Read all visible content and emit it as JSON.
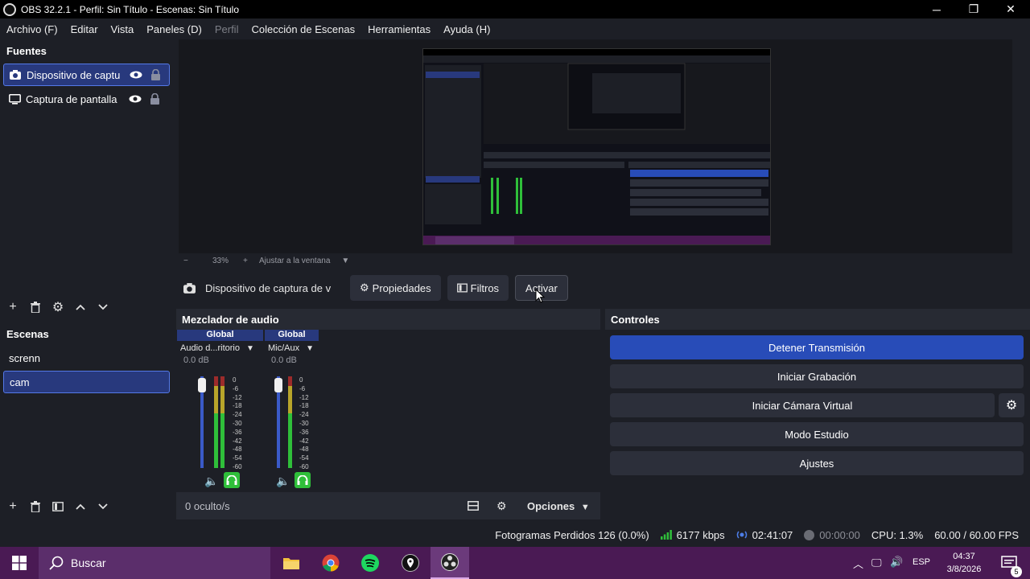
{
  "window": {
    "title": "OBS 32.2.1 - Perfil: Sin Título - Escenas: Sin Título",
    "min": "─",
    "max": "❐",
    "close": "✕"
  },
  "menu": [
    {
      "label": "Archivo (F)",
      "disabled": false
    },
    {
      "label": "Editar",
      "disabled": false
    },
    {
      "label": "Vista",
      "disabled": false
    },
    {
      "label": "Paneles (D)",
      "disabled": false
    },
    {
      "label": "Perfil",
      "disabled": true
    },
    {
      "label": "Colección de Escenas",
      "disabled": false
    },
    {
      "label": "Herramientas",
      "disabled": false
    },
    {
      "label": "Ayuda (H)",
      "disabled": false
    }
  ],
  "sources": {
    "title": "Fuentes",
    "items": [
      {
        "label": "Dispositivo de captu",
        "selected": true,
        "icon": "camera-icon"
      },
      {
        "label": "Captura de pantalla",
        "selected": false,
        "icon": "monitor-icon"
      }
    ]
  },
  "scenes": {
    "title": "Escenas",
    "items": [
      {
        "label": "screnn",
        "selected": false
      },
      {
        "label": "cam",
        "selected": true
      }
    ]
  },
  "zoom": {
    "minus": "−",
    "value": "33%",
    "plus": "+",
    "fit": "Ajustar a la ventana"
  },
  "context": {
    "source_name": "Dispositivo de captura de v",
    "properties": "Propiedades",
    "filters": "Filtros",
    "activate": "Activar"
  },
  "mixer": {
    "title": "Mezclador de audio",
    "channels": [
      {
        "header": "Global",
        "name": "Audio d...ritorio",
        "db": "0.0 dB",
        "fader": 1.0
      },
      {
        "header": "Global",
        "name": "Mic/Aux",
        "db": "0.0 dB",
        "fader": 1.0
      }
    ],
    "scale": [
      "0",
      "-6",
      "-12",
      "-18",
      "-24",
      "-30",
      "-36",
      "-42",
      "-48",
      "-54",
      "-60"
    ],
    "hidden": "0 oculto/s",
    "options": "Opciones"
  },
  "controls": {
    "title": "Controles",
    "stream": "Detener Transmisión",
    "record": "Iniciar Grabación",
    "virtualcam": "Iniciar Cámara Virtual",
    "studio": "Modo Estudio",
    "settings": "Ajustes"
  },
  "status": {
    "dropped": "Fotogramas Perdidos 126 (0.0%)",
    "kbps": "6177 kbps",
    "stream_time": "02:41:07",
    "rec_time": "00:00:00",
    "cpu": "CPU: 1.3%",
    "fps": "60.00 / 60.00 FPS"
  },
  "taskbar": {
    "search": "Buscar",
    "lang": "ESP",
    "time": "04:37",
    "date": "3/8/2026",
    "notifications": "5"
  },
  "colors": {
    "accent": "#284cb8",
    "selected": "#28397d",
    "taskbar": "#4a1a54",
    "meter_green": "#2fbf3a",
    "meter_yellow": "#b8a52a",
    "meter_red": "#9c2b2b"
  }
}
